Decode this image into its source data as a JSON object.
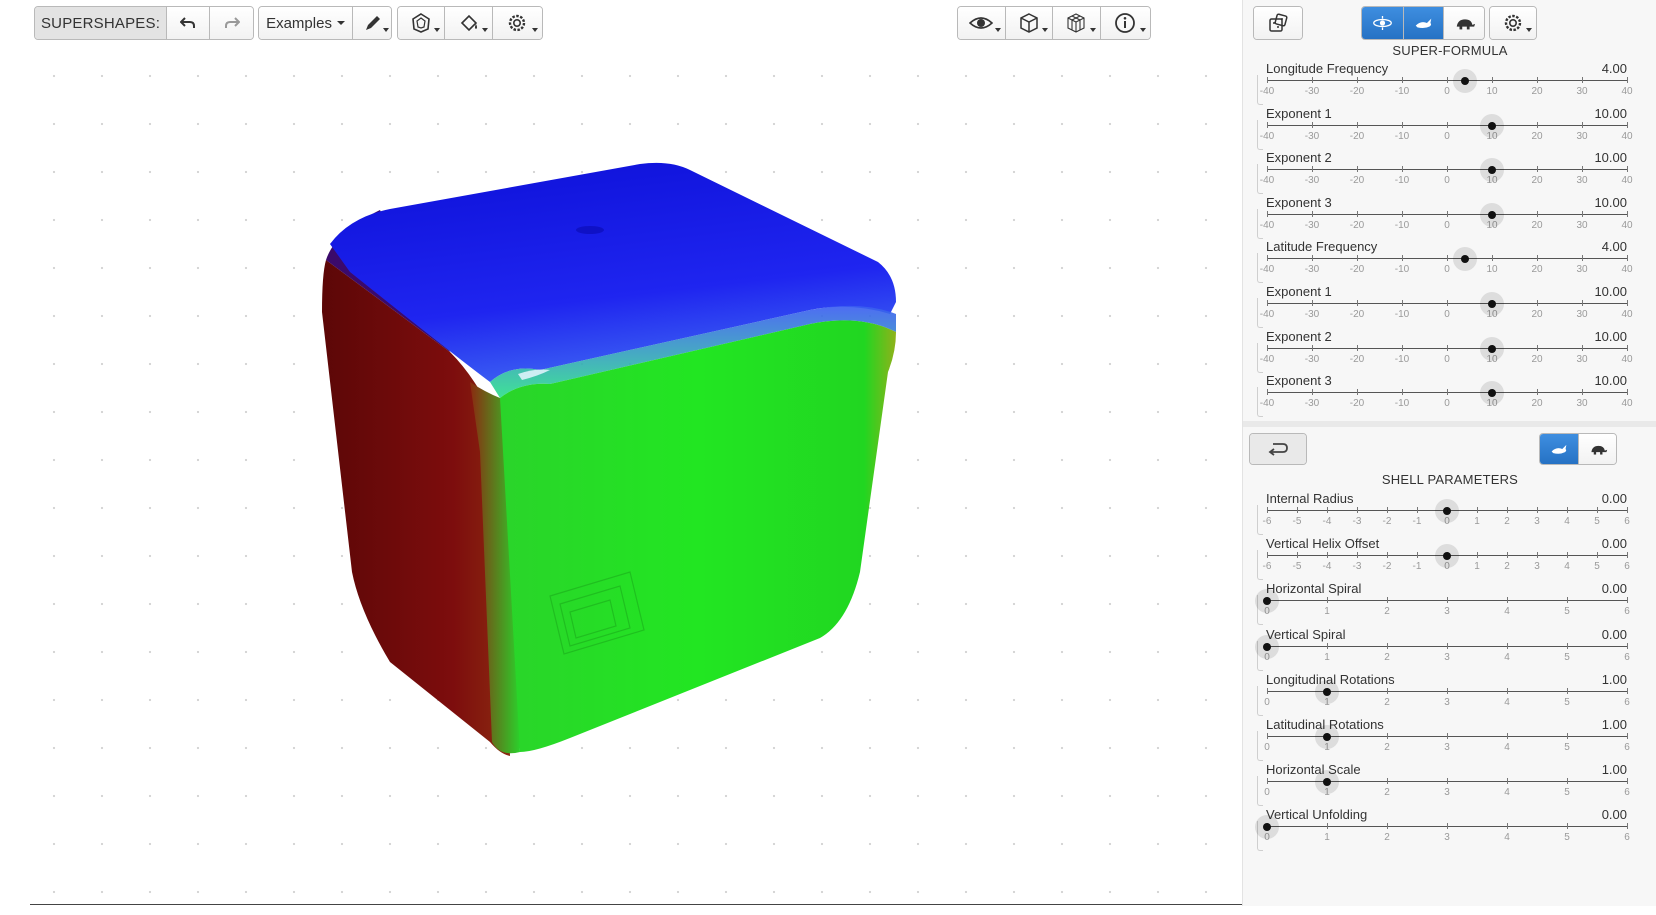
{
  "toolbar": {
    "brand": "SUPERSHAPES:",
    "examples_label": "Examples"
  },
  "icons": {
    "undo": "undo-icon",
    "redo": "redo-icon",
    "pencil": "pencil-icon",
    "shape": "polygon-shape-icon",
    "fill": "paint-bucket-icon",
    "settings": "gear-icon",
    "eye": "eye-icon",
    "cube": "cube-icon",
    "wireframe": "wireframe-cube-icon",
    "info": "info-icon",
    "random": "dice-icon",
    "orbit": "orbit-view-icon",
    "fast": "rabbit-icon",
    "slow": "turtle-icon",
    "back": "return-arrow-icon"
  },
  "colors": {
    "accent": "#2f80d8",
    "cube_top": "#1a1ae6",
    "cube_front": "#22e022",
    "cube_left": "#7a0a0a"
  },
  "superformula": {
    "title": "SUPER-FORMULA",
    "scale": [
      "-40",
      "-30",
      "-20",
      "-10",
      "0",
      "10",
      "20",
      "30",
      "40"
    ],
    "min": -40,
    "max": 40,
    "sliders": [
      {
        "label": "Longitude Frequency",
        "value": "4.00",
        "v": 4
      },
      {
        "label": "Exponent 1",
        "value": "10.00",
        "v": 10
      },
      {
        "label": "Exponent 2",
        "value": "10.00",
        "v": 10
      },
      {
        "label": "Exponent 3",
        "value": "10.00",
        "v": 10
      },
      {
        "label": "Latitude Frequency",
        "value": "4.00",
        "v": 4
      },
      {
        "label": "Exponent 1",
        "value": "10.00",
        "v": 10
      },
      {
        "label": "Exponent 2",
        "value": "10.00",
        "v": 10
      },
      {
        "label": "Exponent 3",
        "value": "10.00",
        "v": 10
      }
    ]
  },
  "shell": {
    "title": "SHELL PARAMETERS",
    "sliders": [
      {
        "label": "Internal Radius",
        "value": "0.00",
        "v": 0,
        "min": -6,
        "max": 6,
        "scale": [
          "-6",
          "-5",
          "-4",
          "-3",
          "-2",
          "-1",
          "0",
          "1",
          "2",
          "3",
          "4",
          "5",
          "6"
        ]
      },
      {
        "label": "Vertical Helix Offset",
        "value": "0.00",
        "v": 0,
        "min": -6,
        "max": 6,
        "scale": [
          "-6",
          "-5",
          "-4",
          "-3",
          "-2",
          "-1",
          "0",
          "1",
          "2",
          "3",
          "4",
          "5",
          "6"
        ]
      },
      {
        "label": "Horizontal Spiral",
        "value": "0.00",
        "v": 0,
        "min": 0,
        "max": 6,
        "scale": [
          "0",
          "1",
          "2",
          "3",
          "4",
          "5",
          "6"
        ]
      },
      {
        "label": "Vertical Spiral",
        "value": "0.00",
        "v": 0,
        "min": 0,
        "max": 6,
        "scale": [
          "0",
          "1",
          "2",
          "3",
          "4",
          "5",
          "6"
        ]
      },
      {
        "label": "Longitudinal Rotations",
        "value": "1.00",
        "v": 1,
        "min": 0,
        "max": 6,
        "scale": [
          "0",
          "1",
          "2",
          "3",
          "4",
          "5",
          "6"
        ]
      },
      {
        "label": "Latitudinal Rotations",
        "value": "1.00",
        "v": 1,
        "min": 0,
        "max": 6,
        "scale": [
          "0",
          "1",
          "2",
          "3",
          "4",
          "5",
          "6"
        ]
      },
      {
        "label": "Horizontal Scale",
        "value": "1.00",
        "v": 1,
        "min": 0,
        "max": 6,
        "scale": [
          "0",
          "1",
          "2",
          "3",
          "4",
          "5",
          "6"
        ]
      },
      {
        "label": "Vertical Unfolding",
        "value": "0.00",
        "v": 0,
        "min": 0,
        "max": 6,
        "scale": [
          "0",
          "1",
          "2",
          "3",
          "4",
          "5",
          "6"
        ]
      }
    ]
  }
}
